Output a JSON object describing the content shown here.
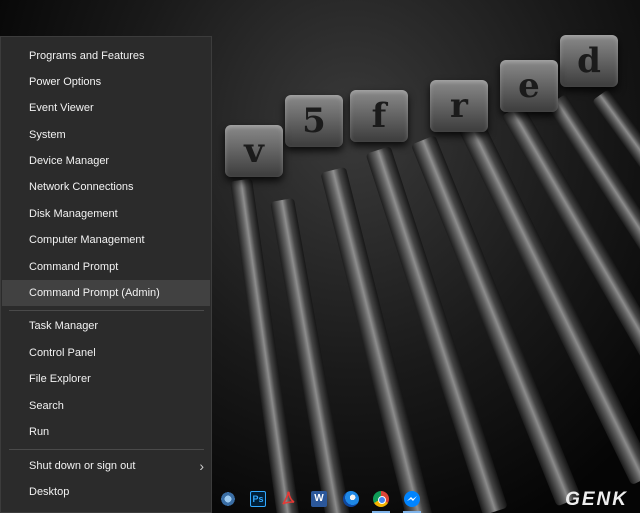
{
  "menu": {
    "group1": [
      {
        "label": "Programs and Features"
      },
      {
        "label": "Power Options"
      },
      {
        "label": "Event Viewer"
      },
      {
        "label": "System"
      },
      {
        "label": "Device Manager"
      },
      {
        "label": "Network Connections"
      },
      {
        "label": "Disk Management"
      },
      {
        "label": "Computer Management"
      },
      {
        "label": "Command Prompt"
      },
      {
        "label": "Command Prompt (Admin)"
      }
    ],
    "group2": [
      {
        "label": "Task Manager"
      },
      {
        "label": "Control Panel"
      },
      {
        "label": "File Explorer"
      },
      {
        "label": "Search"
      },
      {
        "label": "Run"
      }
    ],
    "group3": [
      {
        "label": "Shut down or sign out"
      },
      {
        "label": "Desktop"
      }
    ]
  },
  "taskbar": {
    "ps_label": "Ps",
    "word_label": "W",
    "brand": "GENK"
  },
  "wallpaper": {
    "slugs": [
      "d",
      "e",
      "r",
      "f",
      "5",
      "v"
    ]
  },
  "colors": {
    "menu_bg": "#2b2b2b",
    "menu_hover": "#414141",
    "menu_text": "#f2f2f2",
    "photoshop": "#001e36",
    "word": "#2b579a",
    "chrome": "#db4437",
    "messenger": "#0084ff"
  }
}
